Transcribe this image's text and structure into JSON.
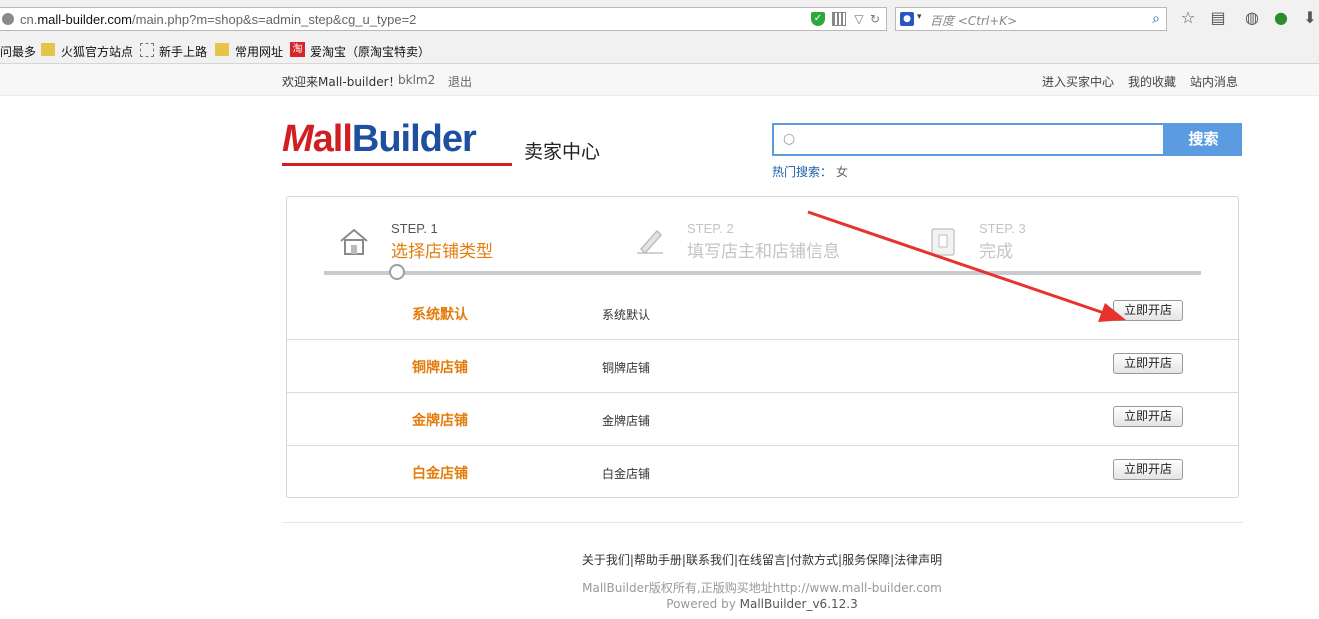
{
  "browser": {
    "url_prefix": "cn.",
    "url_domain": "mall-builder.com",
    "url_path": "/main.php?m=shop&s=admin_step&cg_u_type=2",
    "search_placeholder": "百度 <Ctrl+K>",
    "bookmarks": [
      "问最多",
      "火狐官方站点",
      "新手上路",
      "常用网址",
      "爱淘宝（原淘宝特卖）"
    ]
  },
  "topbar": {
    "welcome": "欢迎来Mall-builder！",
    "username": "bklm2",
    "logout": "退出",
    "buyer_center": "进入买家中心",
    "favorites": "我的收藏",
    "messages": "站内消息"
  },
  "header": {
    "logo_m": "M",
    "logo_all": "all",
    "logo_builder": "Builder",
    "subtitle": "卖家中心",
    "search_button": "搜索",
    "hot_label": "热门搜索：",
    "hot_word": "女"
  },
  "steps": [
    {
      "num": "STEP. 1",
      "name": "选择店铺类型"
    },
    {
      "num": "STEP. 2",
      "name": "填写店主和店铺信息"
    },
    {
      "num": "STEP. 3",
      "name": "完成"
    }
  ],
  "shop_types": [
    {
      "name": "系统默认",
      "desc": "系统默认",
      "action": "立即开店"
    },
    {
      "name": "铜牌店铺",
      "desc": "铜牌店铺",
      "action": "立即开店"
    },
    {
      "name": "金牌店铺",
      "desc": "金牌店铺",
      "action": "立即开店"
    },
    {
      "name": "白金店铺",
      "desc": "白金店铺",
      "action": "立即开店"
    }
  ],
  "footer": {
    "links": "关于我们|帮助手册|联系我们|在线留言|付款方式|服务保障|法律声明",
    "copyright": "MallBuilder版权所有,正版购买地址http://www.mall-builder.com",
    "powered_prefix": "Powered by ",
    "powered_product": "MallBuilder_v6.12.3"
  },
  "colors": {
    "accent_orange": "#e37d0d",
    "search_blue": "#5b9be0",
    "logo_red": "#d01e22",
    "logo_blue": "#1f4fa0",
    "arrow_red": "#e8322d"
  }
}
